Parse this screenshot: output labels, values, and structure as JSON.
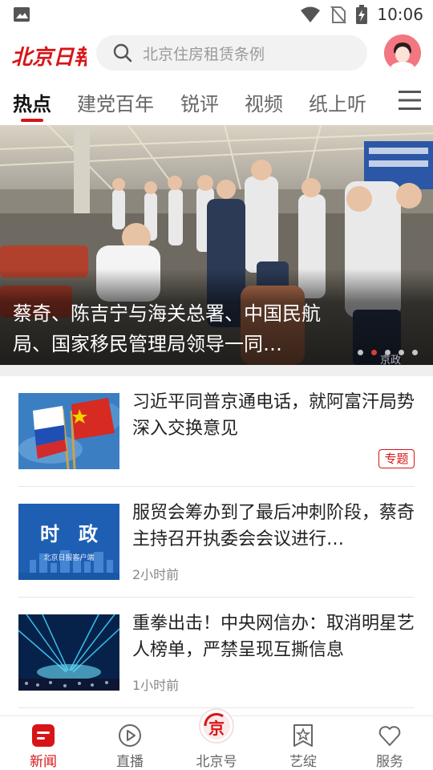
{
  "status_bar": {
    "time": "10:06",
    "icons": [
      "image-icon",
      "wifi-icon",
      "no-sim-icon",
      "battery-charging-icon"
    ]
  },
  "header": {
    "logo_text": "北京日报",
    "search_placeholder": "北京住房租赁条例",
    "avatar": "user-avatar"
  },
  "tabs": {
    "items": [
      "热点",
      "建党百年",
      "锐评",
      "视频",
      "纸上听"
    ],
    "active_index": 0,
    "menu_icon": "hamburger-icon"
  },
  "banner": {
    "title": "蔡奇、陈吉宁与海关总署、中国民航局、国家移民管理局领导一同…",
    "watermark": "京政",
    "dots_count": 5,
    "active_dot": 1
  },
  "news": [
    {
      "title": "习近平同普京通电话，就阿富汗局势深入交换意见",
      "badge": "专题",
      "time": ""
    },
    {
      "title": "服贸会筹办到了最后冲刺阶段，蔡奇主持召开执委会会议进行…",
      "badge": "",
      "time": "2小时前",
      "thumb_text": "时　政",
      "thumb_subtext": "北京日报客户端"
    },
    {
      "title": "重拳出击！中央网信办：取消明星艺人榜单，严禁呈现互撕信息",
      "badge": "",
      "time": "1小时前"
    }
  ],
  "bottom_nav": {
    "items": [
      {
        "label": "新闻",
        "icon": "news-icon",
        "active": true
      },
      {
        "label": "直播",
        "icon": "play-icon",
        "active": false
      },
      {
        "label": "北京号",
        "icon": "beijing-hao-icon",
        "active": false
      },
      {
        "label": "艺绽",
        "icon": "star-bookmark-icon",
        "active": false
      },
      {
        "label": "服务",
        "icon": "heart-icon",
        "active": false
      }
    ],
    "center_icon_char": "京"
  },
  "colors": {
    "brand_red": "#d71518",
    "tab_text": "#666666",
    "search_bg": "#f2f2f2"
  }
}
